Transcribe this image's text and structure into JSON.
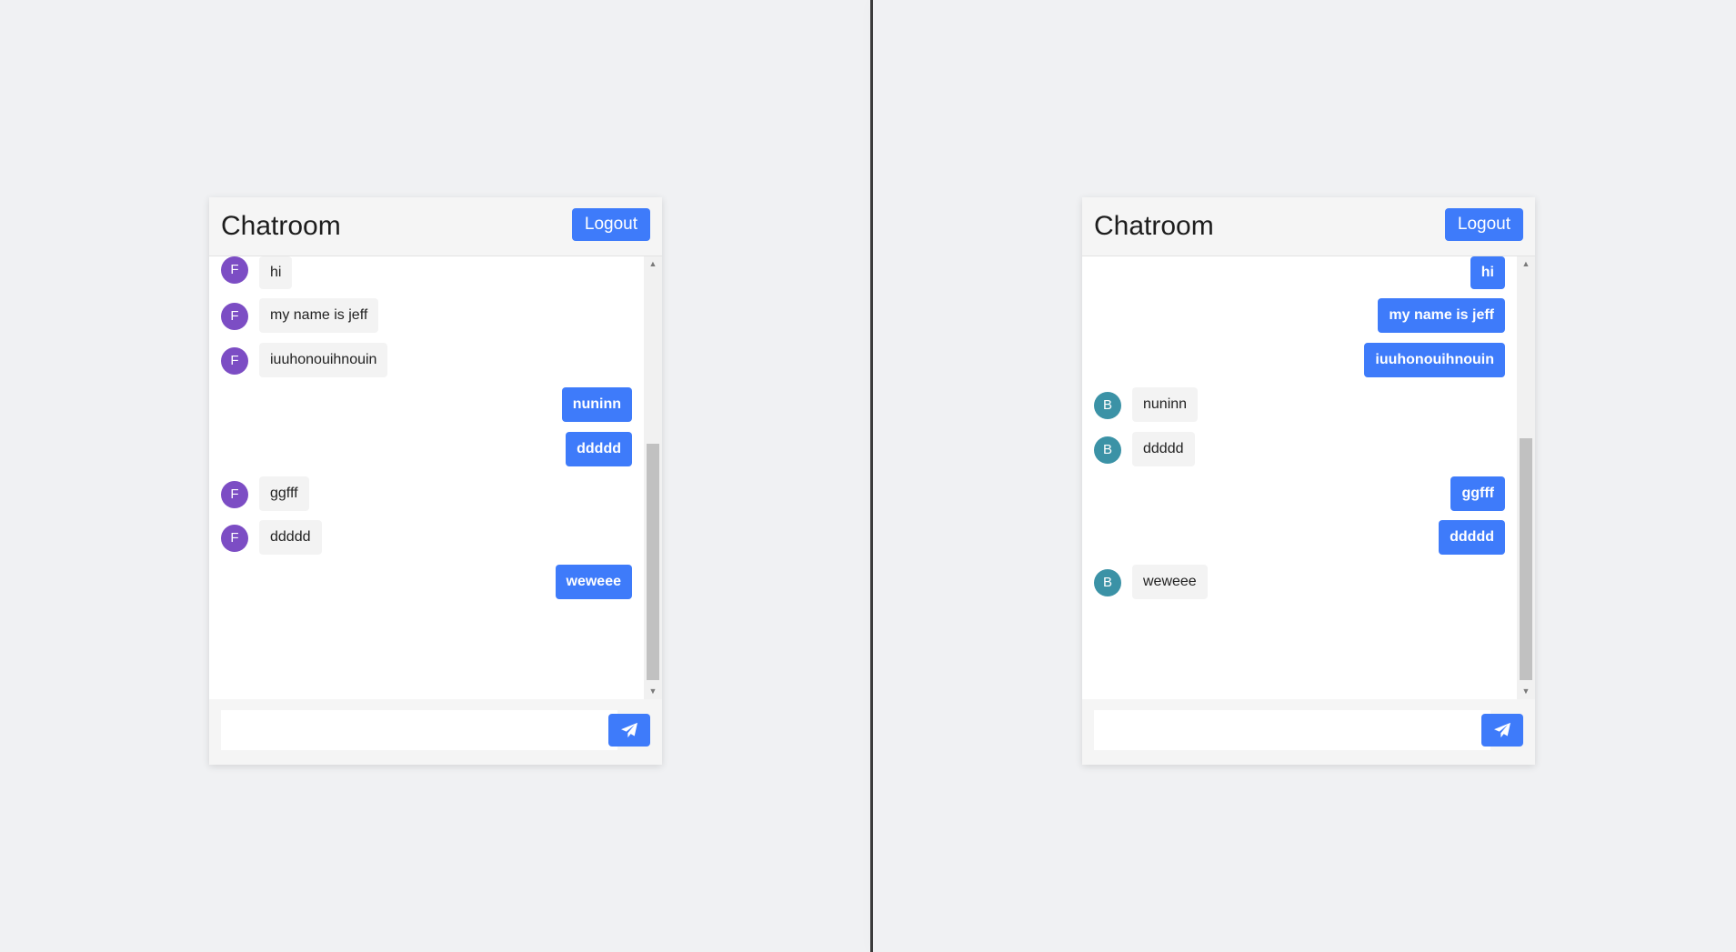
{
  "colors": {
    "accent": "#3e7bfa",
    "avatar_f": "#7c4dc4",
    "avatar_b": "#3b92a6",
    "incoming_bubble": "#f3f3f3",
    "page_background": "#f0f1f3"
  },
  "left": {
    "header": {
      "title": "Chatroom",
      "logout_label": "Logout"
    },
    "messages": [
      {
        "direction": "in",
        "avatar": "F",
        "text": "hi"
      },
      {
        "direction": "in",
        "avatar": "F",
        "text": "my name is jeff"
      },
      {
        "direction": "in",
        "avatar": "F",
        "text": "iuuhonouihnouin"
      },
      {
        "direction": "out",
        "text": "nuninn"
      },
      {
        "direction": "out",
        "text": "ddddd"
      },
      {
        "direction": "in",
        "avatar": "F",
        "text": "ggfff"
      },
      {
        "direction": "in",
        "avatar": "F",
        "text": "ddddd"
      },
      {
        "direction": "out",
        "text": "weweee"
      }
    ],
    "input": {
      "value": "",
      "placeholder": ""
    },
    "send_icon": "paper-plane-icon"
  },
  "right": {
    "header": {
      "title": "Chatroom",
      "logout_label": "Logout"
    },
    "messages": [
      {
        "direction": "out",
        "text": "hi"
      },
      {
        "direction": "out",
        "text": "my name is jeff"
      },
      {
        "direction": "out",
        "text": "iuuhonouihnouin"
      },
      {
        "direction": "in",
        "avatar": "B",
        "text": "nuninn"
      },
      {
        "direction": "in",
        "avatar": "B",
        "text": "ddddd"
      },
      {
        "direction": "out",
        "text": "ggfff"
      },
      {
        "direction": "out",
        "text": "ddddd"
      },
      {
        "direction": "in",
        "avatar": "B",
        "text": "weweee"
      }
    ],
    "input": {
      "value": "",
      "placeholder": ""
    },
    "send_icon": "paper-plane-icon"
  }
}
